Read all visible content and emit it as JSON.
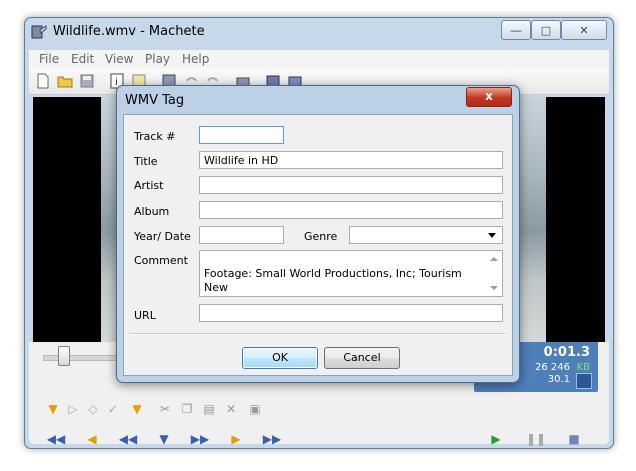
{
  "window": {
    "title": "Wildlife.wmv - Machete"
  },
  "menu": [
    "File",
    "Edit",
    "View",
    "Play",
    "Help"
  ],
  "toolbar": {
    "icons": [
      "new-file-icon",
      "open-folder-icon",
      "save-icon",
      "info-icon",
      "tag-edit-icon",
      "film-icon",
      "undo-icon",
      "redo-icon",
      "camera-icon",
      "frame-icon",
      "export-icon"
    ]
  },
  "status": {
    "time": "0:01.3",
    "size": "26 246",
    "size_unit": "KB",
    "fps": "30.1"
  },
  "dialog": {
    "title": "WMV Tag",
    "close_label": "x",
    "labels": {
      "track": "Track #",
      "title": "Title",
      "artist": "Artist",
      "album": "Album",
      "year": "Year/ Date",
      "genre": "Genre",
      "comment": "Comment",
      "url": "URL"
    },
    "values": {
      "track": "",
      "title": "Wildlife in HD",
      "artist": "",
      "album": "",
      "year": "",
      "genre": "",
      "comment": "Footage: Small World Productions, Inc; Tourism New\nZealand | Producer: Gary F. Spradling | Music: Steve\nBall",
      "url": ""
    },
    "buttons": {
      "ok": "OK",
      "cancel": "Cancel"
    }
  },
  "colors": {
    "accent": "#4f7fb9",
    "play_green": "#1fa51f",
    "marker_orange": "#e0a000"
  }
}
